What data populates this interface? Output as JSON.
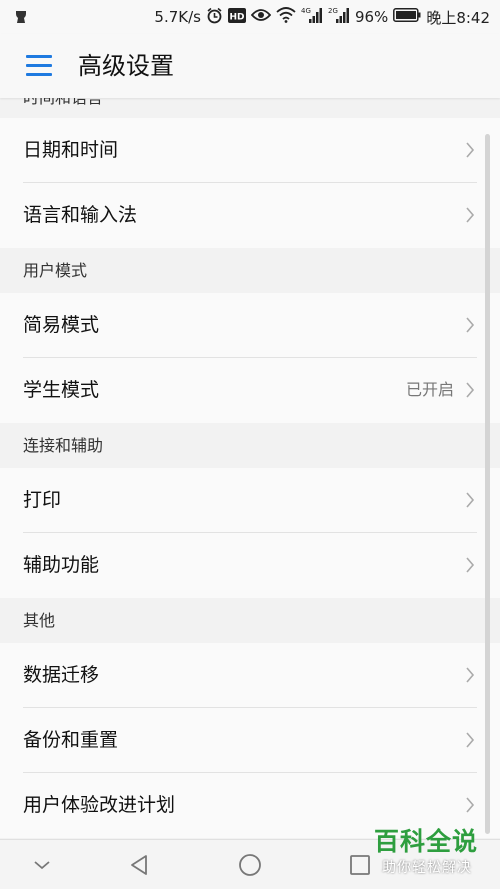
{
  "status_bar": {
    "network_speed": "5.7K/s",
    "signal_1_label": "4G",
    "signal_2_label": "2G",
    "battery": "96%",
    "time": "晚上8:42",
    "icons": [
      "notification-icon",
      "alarm-icon",
      "hd-icon",
      "eye-comfort-icon",
      "wifi-icon",
      "signal-icon",
      "battery-icon"
    ]
  },
  "app_bar": {
    "title": "高级设置",
    "menu_icon": "hamburger-menu-icon",
    "accent_color": "#1f7ae0"
  },
  "sections": {
    "cut_header": "时间和语言",
    "time_language_items": [
      {
        "label": "日期和时间"
      },
      {
        "label": "语言和输入法"
      }
    ],
    "user_mode_header": "用户模式",
    "user_mode_items": [
      {
        "label": "简易模式",
        "value": ""
      },
      {
        "label": "学生模式",
        "value": "已开启"
      }
    ],
    "connect_assist_header": "连接和辅助",
    "connect_assist_items": [
      {
        "label": "打印"
      },
      {
        "label": "辅助功能"
      }
    ],
    "other_header": "其他",
    "other_items": [
      {
        "label": "数据迁移"
      },
      {
        "label": "备份和重置"
      },
      {
        "label": "用户体验改进计划"
      }
    ]
  },
  "nav_bar": {
    "buttons": [
      "hide-nav-icon",
      "back-icon",
      "home-icon",
      "recents-icon"
    ]
  },
  "watermark": {
    "title": "百科全说",
    "subtitle": "助你轻松解决",
    "color": "#2e9e3f"
  }
}
